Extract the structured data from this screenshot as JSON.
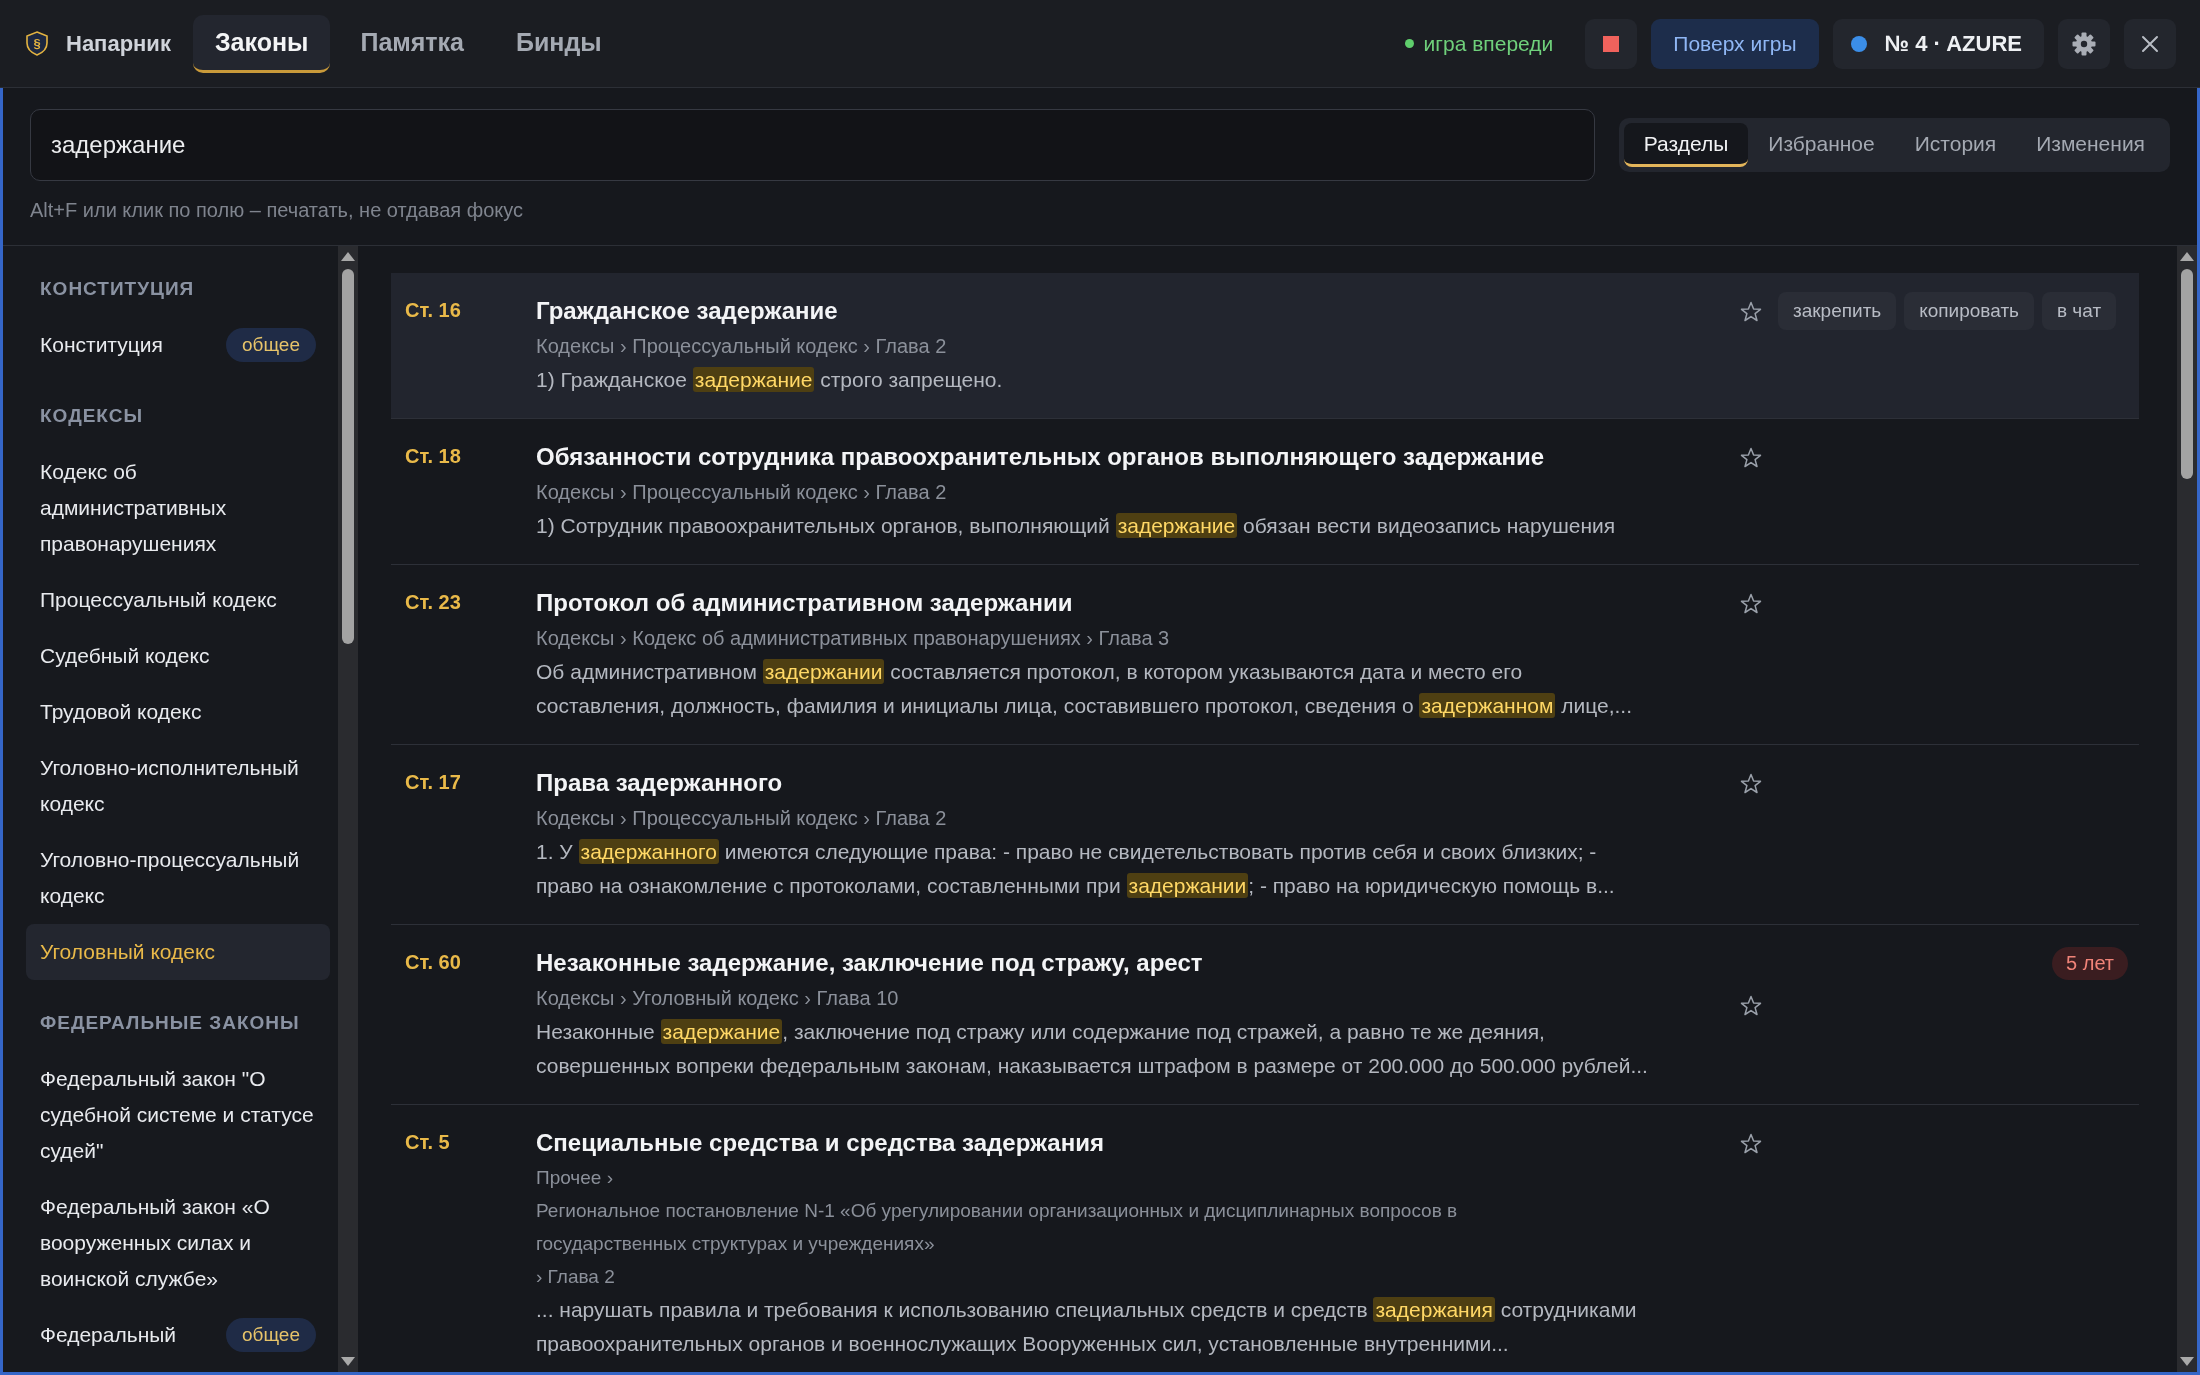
{
  "app": {
    "logo_glyph": "§",
    "name": "Напарник"
  },
  "nav_tabs": [
    {
      "label": "Законы",
      "selected": true
    },
    {
      "label": "Памятка",
      "selected": false
    },
    {
      "label": "Бинды",
      "selected": false
    }
  ],
  "status": {
    "text": "игра впереди"
  },
  "toolbar": {
    "overlay_button": "Поверх игры",
    "server": "№ 4 · AZURE"
  },
  "search": {
    "value": "задержание",
    "hint": "Alt+F или клик по полю – печатать, не отдавая фокус"
  },
  "view_tabs": [
    {
      "label": "Разделы",
      "selected": true
    },
    {
      "label": "Избранное",
      "selected": false
    },
    {
      "label": "История",
      "selected": false
    },
    {
      "label": "Изменения",
      "selected": false
    }
  ],
  "sidebar": {
    "sections": [
      {
        "title": "КОНСТИТУЦИЯ",
        "items": [
          {
            "label": "Конституция",
            "badge": "общее",
            "selected": false
          }
        ]
      },
      {
        "title": "КОДЕКСЫ",
        "items": [
          {
            "label": "Кодекс об административных правонарушениях",
            "selected": false
          },
          {
            "label": "Процессуальный кодекс",
            "selected": false
          },
          {
            "label": "Судебный кодекс",
            "selected": false
          },
          {
            "label": "Трудовой кодекс",
            "selected": false
          },
          {
            "label": "Уголовно-исполнительный кодекс",
            "selected": false
          },
          {
            "label": "Уголовно-процессуальный кодекс",
            "selected": false
          },
          {
            "label": "Уголовный кодекс",
            "selected": true
          }
        ]
      },
      {
        "title": "ФЕДЕРАЛЬНЫЕ ЗАКОНЫ",
        "items": [
          {
            "label": "Федеральный закон \"О судебной системе и статусе судей\"",
            "selected": false
          },
          {
            "label": "Федеральный закон «О вооруженных силах и воинской службе»",
            "selected": false
          },
          {
            "label": "Федеральный",
            "badge": "общее",
            "selected": false
          }
        ]
      }
    ]
  },
  "results": [
    {
      "article": "Ст. 16",
      "title": "Гражданское задержание",
      "path": [
        "Кодексы › Процессуальный кодекс › Глава 2"
      ],
      "snippet": [
        [
          {
            "text": "1) Гражданское ",
            "highlighted": false
          },
          {
            "text": "задержание",
            "highlighted": true
          },
          {
            "text": " строго запрещено.",
            "highlighted": false
          }
        ]
      ],
      "selected": true,
      "starred": false,
      "actions": [
        "закрепить",
        "копировать",
        "в чат"
      ]
    },
    {
      "article": "Ст. 18",
      "title": "Обязанности сотрудника правоохранительных органов выполняющего задержание",
      "path": [
        "Кодексы › Процессуальный кодекс › Глава 2"
      ],
      "snippet": [
        [
          {
            "text": "1) Сотрудник правоохранительных органов, выполняющий ",
            "highlighted": false
          },
          {
            "text": "задержание",
            "highlighted": true
          },
          {
            "text": " обязан вести видеозапись нарушения",
            "highlighted": false
          }
        ]
      ],
      "selected": false,
      "starred": false
    },
    {
      "article": "Ст. 23",
      "title": "Протокол об административном задержании",
      "path": [
        "Кодексы › Кодекс об административных правонарушениях › Глава 3"
      ],
      "snippet": [
        [
          {
            "text": "Об административном ",
            "highlighted": false
          },
          {
            "text": "задержании",
            "highlighted": true
          },
          {
            "text": " составляется протокол, в котором указываются дата и место его",
            "highlighted": false
          }
        ],
        [
          {
            "text": "составления, должность, фамилия и инициалы лица, составившего протокол, сведения о ",
            "highlighted": false
          },
          {
            "text": "задержанном",
            "highlighted": true
          },
          {
            "text": " лице,...",
            "highlighted": false
          }
        ]
      ],
      "selected": false,
      "starred": false
    },
    {
      "article": "Ст. 17",
      "title": "Права задержанного",
      "path": [
        "Кодексы › Процессуальный кодекс › Глава 2"
      ],
      "snippet": [
        [
          {
            "text": "1. У ",
            "highlighted": false
          },
          {
            "text": "задержанного",
            "highlighted": true
          },
          {
            "text": " имеются следующие права: - право не свидетельствовать против себя и своих близких; -",
            "highlighted": false
          }
        ],
        [
          {
            "text": "право на ознакомление с протоколами, составленными при ",
            "highlighted": false
          },
          {
            "text": "задержании",
            "highlighted": true
          },
          {
            "text": "; - право на юридическую помощь в...",
            "highlighted": false
          }
        ]
      ],
      "selected": false,
      "starred": false
    },
    {
      "article": "Ст. 60",
      "title": "Незаконные задержание, заключение под стражу, арест",
      "path": [
        "Кодексы › Уголовный кодекс › Глава 10"
      ],
      "badge": "5 лет",
      "snippet": [
        [
          {
            "text": "Незаконные ",
            "highlighted": false
          },
          {
            "text": "задержание",
            "highlighted": true
          },
          {
            "text": ", заключение под стражу или содержание под стражей, а равно те же деяния,",
            "highlighted": false
          }
        ],
        [
          {
            "text": "совершенных вопреки федеральным законам, наказывается штрафом в размере от 200.000 до 500.000 рублей...",
            "highlighted": false
          }
        ]
      ],
      "selected": false,
      "starred": false
    },
    {
      "article": "Ст. 5",
      "title": "Специальные средства и средства задержания",
      "path": [
        "Прочее ›",
        "Региональное постановление N-1 «Об урегулировании организационных и дисциплинарных вопросов в",
        "государственных структурах и учреждениях»",
        "› Глава 2"
      ],
      "snippet": [
        [
          {
            "text": "... нарушать правила и требования к использованию специальных средств и средств ",
            "highlighted": false
          },
          {
            "text": "задержания",
            "highlighted": true
          },
          {
            "text": " сотрудниками",
            "highlighted": false
          }
        ],
        [
          {
            "text": "правоохранительных органов и военнослужащих Вооруженных сил, установленные внутренними...",
            "highlighted": false
          }
        ]
      ],
      "selected": false,
      "starred": false
    }
  ]
}
